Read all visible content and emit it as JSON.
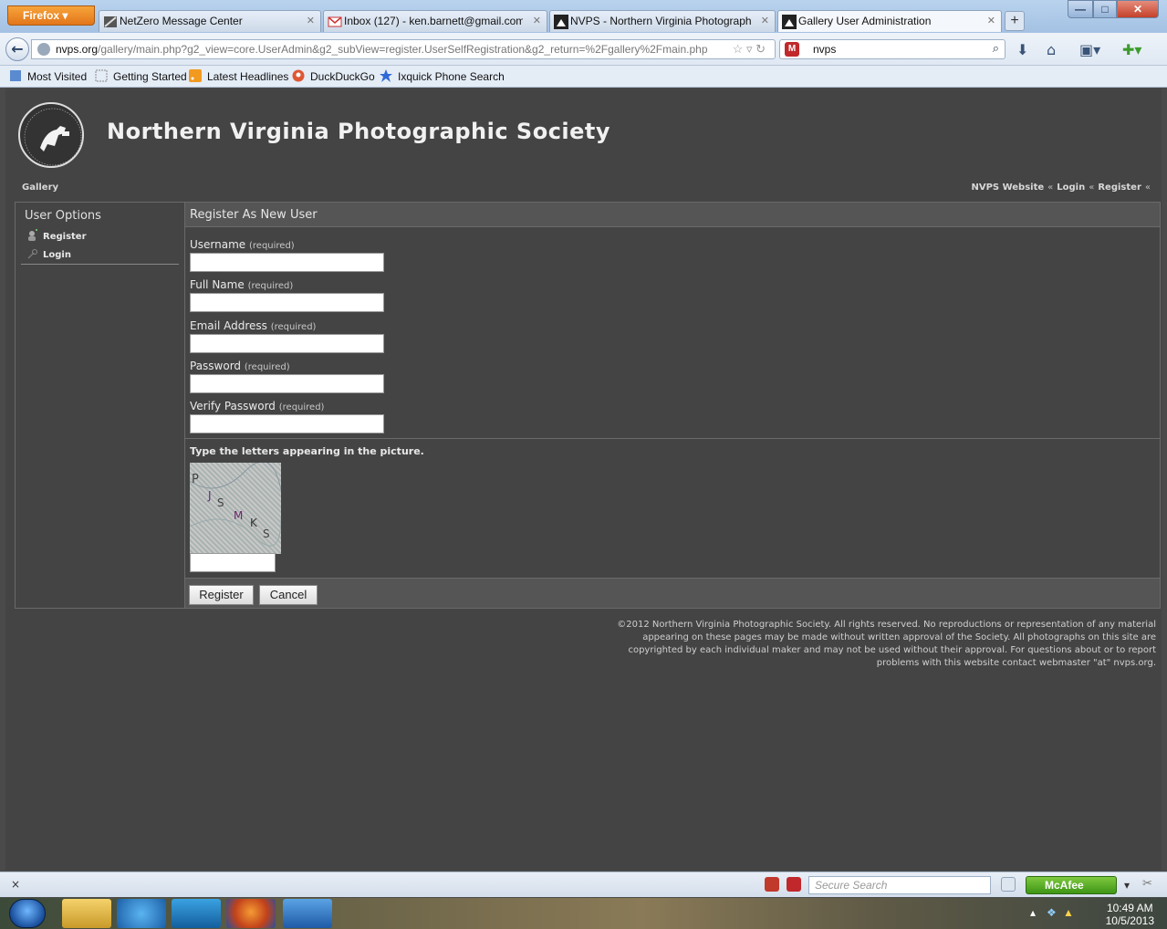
{
  "browser": {
    "app_button": "Firefox",
    "tabs": [
      {
        "title": "NetZero Message Center",
        "active": false
      },
      {
        "title": "Inbox (127) - ken.barnett@gmail.com...",
        "active": false
      },
      {
        "title": "NVPS - Northern Virginia Photograph...",
        "active": false
      },
      {
        "title": "Gallery User Administration",
        "active": true
      }
    ],
    "new_tab": "+",
    "url_domain": "nvps.org",
    "url_path": "/gallery/main.php?g2_view=core.UserAdmin&g2_subView=register.UserSelfRegistration&g2_return=%2Fgallery%2Fmain.php",
    "search_value": "nvps",
    "bookmarks": [
      "Most Visited",
      "Getting Started",
      "Latest Headlines",
      "DuckDuckGo",
      "Ixquick Phone Search"
    ]
  },
  "site": {
    "title": "Northern Virginia Photographic Society",
    "breadcrumb": "Gallery",
    "top_links": [
      "NVPS Website",
      "Login",
      "Register"
    ],
    "separator": "«"
  },
  "sidebar": {
    "title": "User Options",
    "items": [
      "Register",
      "Login"
    ]
  },
  "form": {
    "heading": "Register As New User",
    "required_note": "(required)",
    "fields": [
      {
        "label": "Username",
        "value": ""
      },
      {
        "label": "Full Name",
        "value": ""
      },
      {
        "label": "Email Address",
        "value": ""
      },
      {
        "label": "Password",
        "value": ""
      },
      {
        "label": "Verify Password",
        "value": ""
      }
    ],
    "captcha_prompt": "Type the letters appearing in the picture.",
    "captcha_letters": [
      "P",
      "J",
      "S",
      "M",
      "K",
      "S"
    ],
    "buttons": {
      "register": "Register",
      "cancel": "Cancel"
    }
  },
  "footer": "©2012 Northern Virginia Photographic Society. All rights reserved. No reproductions or representation of any material appearing on these pages may be made without written approval of the Society. All photographs on this site are copyrighted by each individual maker and may not be used without their approval. For questions about or to report problems with this website contact webmaster \"at\" nvps.org.",
  "statusbar": {
    "close": "×",
    "secure_search_placeholder": "Secure Search",
    "mcafee": "McAfee"
  },
  "taskbar": {
    "time": "10:49 AM",
    "date": "10/5/2013"
  },
  "colors": {
    "page_background": "#444444",
    "panel_header": "#555555",
    "firefox_orange": "#e2761b"
  }
}
